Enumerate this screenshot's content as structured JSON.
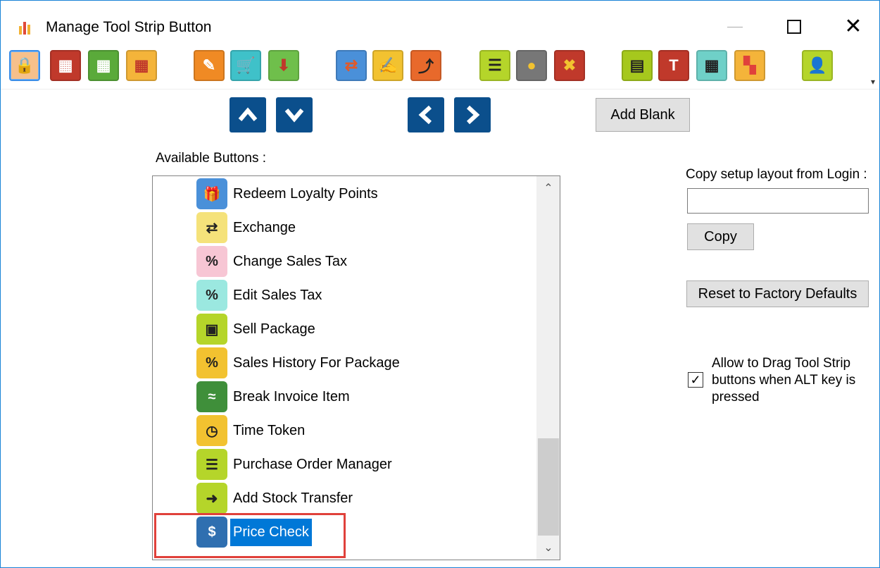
{
  "window": {
    "title": "Manage Tool Strip Button",
    "minimize_icon": "minimize-icon",
    "maximize_icon": "maximize-icon",
    "close_glyph": "✕"
  },
  "toolstrip": {
    "tools": [
      {
        "name": "lock-icon",
        "glyph": "🔒",
        "bg": "#f6c08b",
        "fg": "#111"
      },
      {
        "name": "register-icon",
        "glyph": "▦",
        "bg": "#c0392b",
        "fg": "#fff"
      },
      {
        "name": "register-transfer-icon",
        "glyph": "▦",
        "bg": "#5aaa3a",
        "fg": "#fff"
      },
      {
        "name": "register-export-icon",
        "glyph": "▦",
        "bg": "#f4b43a",
        "fg": "#c0392b"
      },
      {
        "name": "edit-note-icon",
        "glyph": "✎",
        "bg": "#f08a24",
        "fg": "#fff"
      },
      {
        "name": "cart-icon",
        "glyph": "🛒",
        "bg": "#3fc1c9",
        "fg": "#333"
      },
      {
        "name": "download-box-icon",
        "glyph": "⬇",
        "bg": "#6fbf4b",
        "fg": "#c0392b"
      },
      {
        "name": "transfer-boxes-icon",
        "glyph": "⇄",
        "bg": "#4a90d9",
        "fg": "#e05a2b"
      },
      {
        "name": "memo-edit-icon",
        "glyph": "✍",
        "bg": "#f2c230",
        "fg": "#333"
      },
      {
        "name": "return-item-icon",
        "glyph": "⤴",
        "bg": "#e8692b",
        "fg": "#222"
      },
      {
        "name": "checklist-icon",
        "glyph": "☰",
        "bg": "#b5d52a",
        "fg": "#222"
      },
      {
        "name": "spot-icon",
        "glyph": "●",
        "bg": "#777777",
        "fg": "#f2c230"
      },
      {
        "name": "cancel-icon",
        "glyph": "✖",
        "bg": "#c0392b",
        "fg": "#f2c230"
      },
      {
        "name": "calculator-icon",
        "glyph": "▤",
        "bg": "#a6c81d",
        "fg": "#222"
      },
      {
        "name": "tyxg-icon",
        "glyph": "T",
        "bg": "#c0392b",
        "fg": "#fff"
      },
      {
        "name": "rs-calculator-icon",
        "glyph": "▦",
        "bg": "#6fd0c8",
        "fg": "#222"
      },
      {
        "name": "tiles-icon",
        "glyph": "▚",
        "bg": "#f4b43a",
        "fg": "#e0413b"
      },
      {
        "name": "user-icon",
        "glyph": "👤",
        "bg": "#b5d52a",
        "fg": "#2f6fb0"
      }
    ],
    "overflow_glyph": "▾"
  },
  "arrows": {
    "up_icon": "arrow-up-icon",
    "down_icon": "arrow-down-icon",
    "left_icon": "arrow-left-icon",
    "right_icon": "arrow-right-icon"
  },
  "add_blank_label": "Add Blank",
  "available_label": "Available  Buttons :",
  "list": {
    "items": [
      {
        "label": "Redeem Loyalty Points",
        "icon": "gift-icon",
        "glyph": "🎁",
        "bg": "#4a90d9"
      },
      {
        "label": "Exchange",
        "icon": "exchange-icon",
        "glyph": "⇄",
        "bg": "#f5e27a"
      },
      {
        "label": "Change Sales Tax",
        "icon": "percent-change-icon",
        "glyph": "%",
        "bg": "#f7c6d4"
      },
      {
        "label": "Edit Sales Tax",
        "icon": "percent-edit-icon",
        "glyph": "%",
        "bg": "#9be8e0"
      },
      {
        "label": "Sell Package",
        "icon": "package-icon",
        "glyph": "▣",
        "bg": "#b5d52a"
      },
      {
        "label": "Sales History For Package",
        "icon": "package-history-icon",
        "glyph": "%",
        "bg": "#f2c230"
      },
      {
        "label": "Break Invoice Item",
        "icon": "break-invoice-icon",
        "glyph": "≈",
        "bg": "#3f8f3a"
      },
      {
        "label": "Time Token",
        "icon": "clock-icon",
        "glyph": "◷",
        "bg": "#f2c230"
      },
      {
        "label": "Purchase Order Manager",
        "icon": "purchase-order-icon",
        "glyph": "☰",
        "bg": "#b5d52a"
      },
      {
        "label": "Add Stock Transfer",
        "icon": "stock-transfer-icon",
        "glyph": "➜",
        "bg": "#b5d52a"
      },
      {
        "label": "Price Check",
        "icon": "dollar-icon",
        "glyph": "$",
        "bg": "#2f6fb0",
        "selected": true
      }
    ],
    "scroll_up_glyph": "⌃",
    "scroll_down_glyph": "⌄"
  },
  "copy_setup_label": "Copy setup layout from Login :",
  "copy_input_value": "",
  "copy_button_label": "Copy",
  "reset_button_label": "Reset to Factory Defaults",
  "allow_drag": {
    "checked": true,
    "check_glyph": "✓",
    "label": "Allow to Drag Tool Strip buttons when ALT key is pressed"
  }
}
